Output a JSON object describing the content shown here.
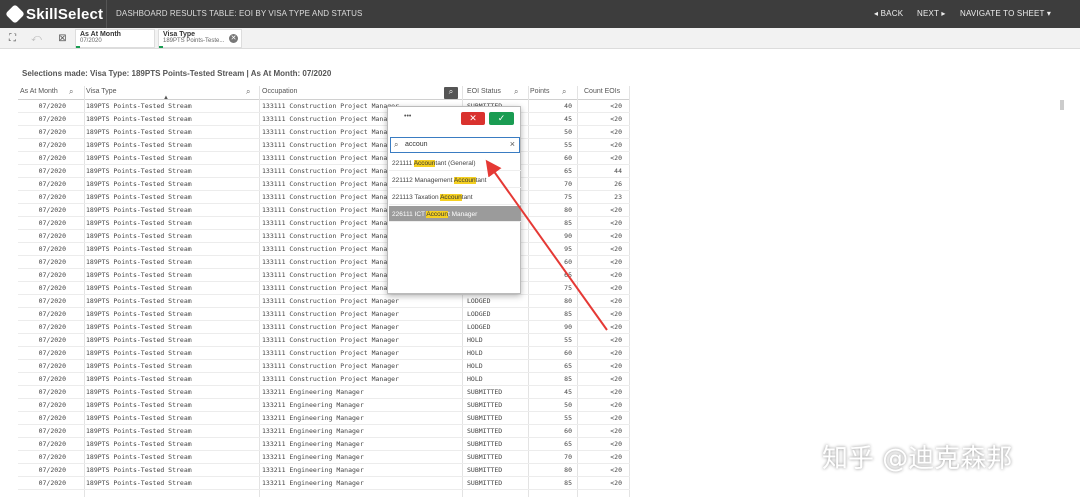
{
  "app": {
    "name": "SkillSelect",
    "sheet_title": "DASHBOARD RESULTS TABLE: EOI BY VISA TYPE AND STATUS"
  },
  "nav": {
    "back": "BACK",
    "next": "NEXT",
    "navigate": "NAVIGATE TO SHEET"
  },
  "selections_bar": {
    "chips": [
      {
        "title": "As At Month",
        "value": "07/2020"
      },
      {
        "title": "Visa Type",
        "value": "189PTS Points-Teste..."
      }
    ]
  },
  "selections_made": "Selections made: Visa Type: 189PTS Points-Tested Stream | As At Month: 07/2020",
  "table": {
    "headers": [
      "As At Month",
      "Visa Type",
      "Occupation",
      "EOI Status",
      "Points",
      "Count EOIs"
    ],
    "rows": [
      [
        "07/2020",
        "189PTS Points-Tested Stream",
        "133111 Construction Project Manager",
        "SUBMITTED",
        "40",
        "<20"
      ],
      [
        "07/2020",
        "189PTS Points-Tested Stream",
        "133111 Construction Project Manager",
        "SUBMITTED",
        "45",
        "<20"
      ],
      [
        "07/2020",
        "189PTS Points-Tested Stream",
        "133111 Construction Project Manager",
        "SUBMITTED",
        "50",
        "<20"
      ],
      [
        "07/2020",
        "189PTS Points-Tested Stream",
        "133111 Construction Project Manager",
        "SUBMITTED",
        "55",
        "<20"
      ],
      [
        "07/2020",
        "189PTS Points-Tested Stream",
        "133111 Construction Project Manager",
        "SUBMITTED",
        "60",
        "<20"
      ],
      [
        "07/2020",
        "189PTS Points-Tested Stream",
        "133111 Construction Project Manager",
        "SUBMITTED",
        "65",
        "44"
      ],
      [
        "07/2020",
        "189PTS Points-Tested Stream",
        "133111 Construction Project Manager",
        "SUBMITTED",
        "70",
        "26"
      ],
      [
        "07/2020",
        "189PTS Points-Tested Stream",
        "133111 Construction Project Manager",
        "SUBMITTED",
        "75",
        "23"
      ],
      [
        "07/2020",
        "189PTS Points-Tested Stream",
        "133111 Construction Project Manager",
        "SUBMITTED",
        "80",
        "<20"
      ],
      [
        "07/2020",
        "189PTS Points-Tested Stream",
        "133111 Construction Project Manager",
        "SUBMITTED",
        "85",
        "<20"
      ],
      [
        "07/2020",
        "189PTS Points-Tested Stream",
        "133111 Construction Project Manager",
        "SUBMITTED",
        "90",
        "<20"
      ],
      [
        "07/2020",
        "189PTS Points-Tested Stream",
        "133111 Construction Project Manager",
        "SUBMITTED",
        "95",
        "<20"
      ],
      [
        "07/2020",
        "189PTS Points-Tested Stream",
        "133111 Construction Project Manager",
        "LODGED",
        "60",
        "<20"
      ],
      [
        "07/2020",
        "189PTS Points-Tested Stream",
        "133111 Construction Project Manager",
        "LODGED",
        "65",
        "<20"
      ],
      [
        "07/2020",
        "189PTS Points-Tested Stream",
        "133111 Construction Project Manager",
        "LODGED",
        "75",
        "<20"
      ],
      [
        "07/2020",
        "189PTS Points-Tested Stream",
        "133111 Construction Project Manager",
        "LODGED",
        "80",
        "<20"
      ],
      [
        "07/2020",
        "189PTS Points-Tested Stream",
        "133111 Construction Project Manager",
        "LODGED",
        "85",
        "<20"
      ],
      [
        "07/2020",
        "189PTS Points-Tested Stream",
        "133111 Construction Project Manager",
        "LODGED",
        "90",
        "<20"
      ],
      [
        "07/2020",
        "189PTS Points-Tested Stream",
        "133111 Construction Project Manager",
        "HOLD",
        "55",
        "<20"
      ],
      [
        "07/2020",
        "189PTS Points-Tested Stream",
        "133111 Construction Project Manager",
        "HOLD",
        "60",
        "<20"
      ],
      [
        "07/2020",
        "189PTS Points-Tested Stream",
        "133111 Construction Project Manager",
        "HOLD",
        "65",
        "<20"
      ],
      [
        "07/2020",
        "189PTS Points-Tested Stream",
        "133111 Construction Project Manager",
        "HOLD",
        "85",
        "<20"
      ],
      [
        "07/2020",
        "189PTS Points-Tested Stream",
        "133211 Engineering Manager",
        "SUBMITTED",
        "45",
        "<20"
      ],
      [
        "07/2020",
        "189PTS Points-Tested Stream",
        "133211 Engineering Manager",
        "SUBMITTED",
        "50",
        "<20"
      ],
      [
        "07/2020",
        "189PTS Points-Tested Stream",
        "133211 Engineering Manager",
        "SUBMITTED",
        "55",
        "<20"
      ],
      [
        "07/2020",
        "189PTS Points-Tested Stream",
        "133211 Engineering Manager",
        "SUBMITTED",
        "60",
        "<20"
      ],
      [
        "07/2020",
        "189PTS Points-Tested Stream",
        "133211 Engineering Manager",
        "SUBMITTED",
        "65",
        "<20"
      ],
      [
        "07/2020",
        "189PTS Points-Tested Stream",
        "133211 Engineering Manager",
        "SUBMITTED",
        "70",
        "<20"
      ],
      [
        "07/2020",
        "189PTS Points-Tested Stream",
        "133211 Engineering Manager",
        "SUBMITTED",
        "80",
        "<20"
      ],
      [
        "07/2020",
        "189PTS Points-Tested Stream",
        "133211 Engineering Manager",
        "SUBMITTED",
        "85",
        "<20"
      ]
    ]
  },
  "search_popup": {
    "more": "•••",
    "query": "accoun",
    "items": [
      {
        "pre": "221111 ",
        "hl": "Accoun",
        "post": "tant (General)"
      },
      {
        "pre": "221112 Management ",
        "hl": "Accoun",
        "post": "tant"
      },
      {
        "pre": "221113 Taxation ",
        "hl": "Accoun",
        "post": "tant"
      },
      {
        "pre": "226111 ICT ",
        "hl": "Accoun",
        "post": "t Manager"
      }
    ]
  },
  "watermark": "知乎 @迪克森邦",
  "colors": {
    "topbar": "#3d3d3d",
    "confirm": "#1a9c52",
    "cancel": "#d9322e",
    "highlight": "#f5d021",
    "arrow": "#e53935"
  }
}
